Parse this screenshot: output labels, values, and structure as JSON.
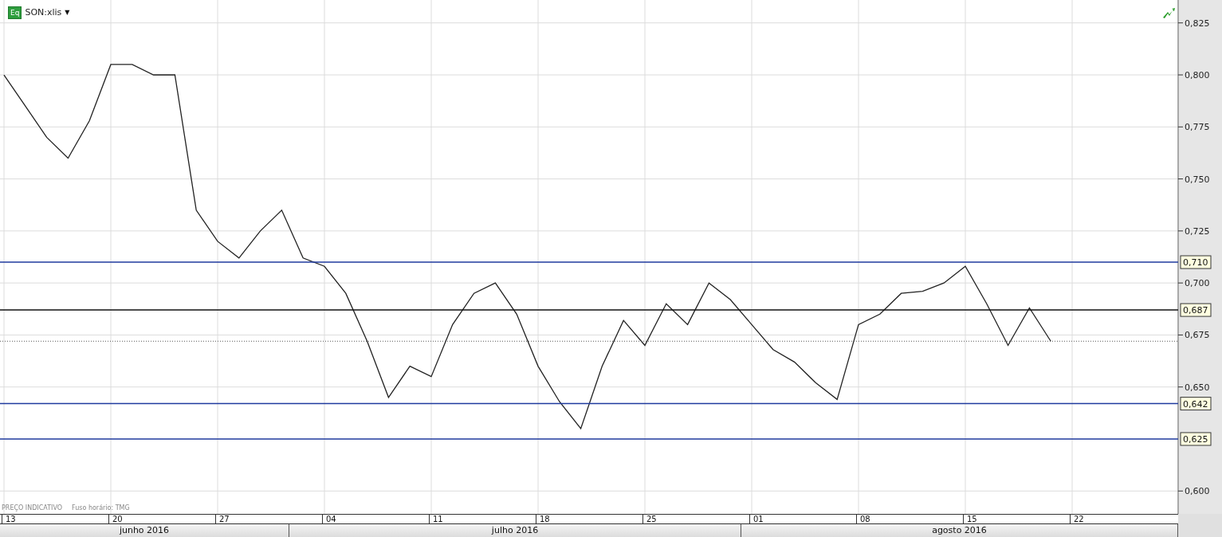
{
  "header": {
    "badge": "Eq",
    "caret": "▼"
  },
  "chart_data": {
    "type": "line",
    "ylim": [
      0.589,
      0.836
    ],
    "categories": [
      "13",
      null,
      null,
      null,
      null,
      "20",
      null,
      null,
      null,
      null,
      "27",
      null,
      null,
      null,
      null,
      "04",
      null,
      null,
      null,
      null,
      "11",
      null,
      null,
      null,
      null,
      "18",
      null,
      null,
      null,
      null,
      "25",
      null,
      null,
      null,
      null,
      "01",
      null,
      null,
      null,
      null,
      "08",
      null,
      null,
      null,
      null,
      "15",
      null,
      null,
      null,
      null,
      "22"
    ],
    "series": [
      {
        "name": "SON:xlis",
        "color": "#222222",
        "values": [
          0.8,
          0.785,
          0.77,
          0.76,
          0.778,
          0.805,
          0.805,
          0.8,
          0.8,
          0.735,
          0.72,
          0.712,
          0.725,
          0.735,
          0.712,
          0.708,
          0.695,
          0.672,
          0.645,
          0.66,
          0.655,
          0.68,
          0.695,
          0.7,
          0.685,
          0.66,
          0.643,
          0.63,
          0.66,
          0.682,
          0.67,
          0.69,
          0.68,
          0.7,
          0.692,
          0.68,
          0.668,
          0.662,
          0.652,
          0.644,
          0.68,
          0.685,
          0.695,
          0.696,
          0.7,
          0.708,
          0.69,
          0.67,
          0.688,
          0.672,
          null
        ]
      }
    ],
    "yticks": [
      {
        "value": 0.825,
        "label": "0,825"
      },
      {
        "value": 0.8,
        "label": "0,800"
      },
      {
        "value": 0.775,
        "label": "0,775"
      },
      {
        "value": 0.75,
        "label": "0,750"
      },
      {
        "value": 0.725,
        "label": "0,725"
      },
      {
        "value": 0.7,
        "label": "0,700"
      },
      {
        "value": 0.675,
        "label": "0,675"
      },
      {
        "value": 0.65,
        "label": "0,650"
      },
      {
        "value": 0.6,
        "label": "0,600"
      }
    ],
    "ref_lines": [
      {
        "axis": "y",
        "value": 0.71,
        "label": "0,710",
        "color": "#1f3a9e"
      },
      {
        "axis": "y",
        "value": 0.687,
        "label": "0,687",
        "color": "#111111"
      },
      {
        "axis": "y",
        "value": 0.672,
        "color": "#555555"
      },
      {
        "axis": "y",
        "value": 0.642,
        "label": "0,642",
        "color": "#1f3a9e"
      },
      {
        "axis": "y",
        "value": 0.625,
        "label": "0,625",
        "color": "#1f3a9e"
      }
    ],
    "grid": true
  },
  "footer": [
    "PREÇO INDICATIVO",
    "Fuso horário: TMG"
  ],
  "months": [
    "junho 2016",
    "julho 2016",
    "agosto 2016"
  ]
}
